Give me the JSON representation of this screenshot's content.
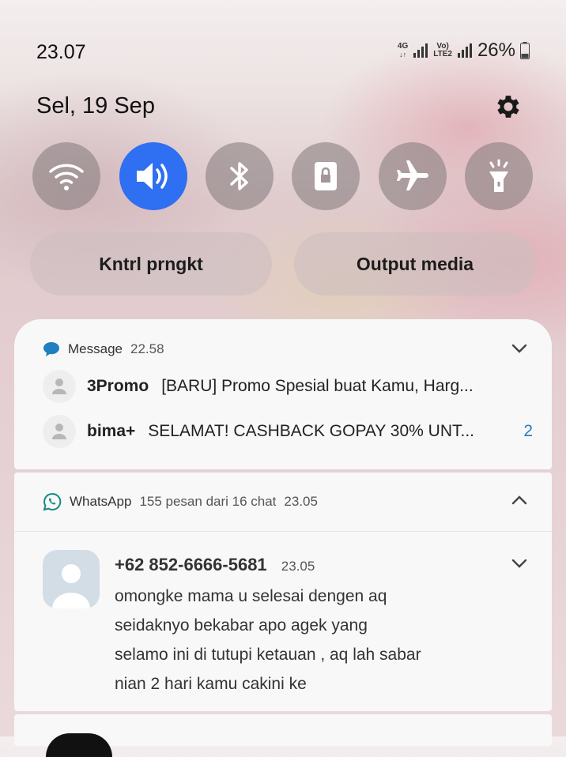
{
  "status": {
    "time": "23.07",
    "net_4g": "4G",
    "volte": "Vo)",
    "lte2": "LTE2",
    "battery": "26%"
  },
  "date": "Sel, 19 Sep",
  "quick_toggles": [
    {
      "name": "wifi-icon",
      "active": false
    },
    {
      "name": "sound-icon",
      "active": true
    },
    {
      "name": "bluetooth-icon",
      "active": false
    },
    {
      "name": "lock-rotation-icon",
      "active": false
    },
    {
      "name": "airplane-icon",
      "active": false
    },
    {
      "name": "flashlight-icon",
      "active": false
    }
  ],
  "pills": {
    "device_control": "Kntrl prngkt",
    "media_output": "Output media"
  },
  "message_group": {
    "app": "Message",
    "time": "22.58",
    "items": [
      {
        "sender": "3Promo",
        "text": "[BARU] Promo Spesial buat Kamu, Harg...",
        "count": ""
      },
      {
        "sender": "bima+",
        "text": "SELAMAT! CASHBACK GOPAY 30% UNT...",
        "count": "2"
      }
    ]
  },
  "whatsapp_group": {
    "app": "WhatsApp",
    "summary": "155 pesan dari 16 chat",
    "time": "23.05",
    "conversation": {
      "sender": "+62 852-6666-5681",
      "time": "23.05",
      "lines": [
        "omongke mama u selesai dengen aq",
        "seidaknyo bekabar apo agek yang",
        "selamo ini di tutupi ketauan , aq lah sabar",
        "nian 2 hari kamu cakini ke"
      ]
    }
  },
  "colors": {
    "accent": "#2f6ff2",
    "message_icon": "#1f7fc0",
    "whatsapp_icon": "#128c7e",
    "count": "#2a7ac0"
  }
}
